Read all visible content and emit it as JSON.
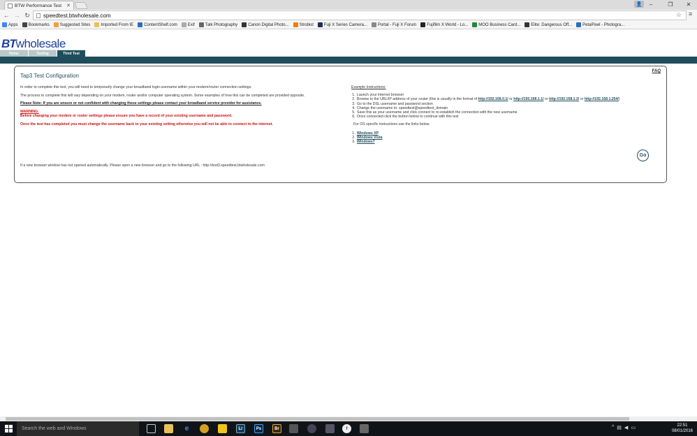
{
  "browser": {
    "tab_title": "BTW Performance Test",
    "url": "speedtest.btwholesale.com",
    "bookmarks": [
      {
        "label": "Apps",
        "icon": "apps-icon",
        "color": "#4285f4"
      },
      {
        "label": "Bookmarks",
        "icon": "star-icon",
        "color": "#444"
      },
      {
        "label": "Suggested Sites",
        "icon": "suggested-icon",
        "color": "#e8a33d"
      },
      {
        "label": "Imported From IE",
        "icon": "folder-icon",
        "color": "#e8c15a"
      },
      {
        "label": "ContentShelf.com",
        "icon": "contentshelf-icon",
        "color": "#2a6ebb"
      },
      {
        "label": "Exif",
        "icon": "document-icon",
        "color": "#aaa"
      },
      {
        "label": "Talk Photography",
        "icon": "talk-icon",
        "color": "#666"
      },
      {
        "label": "Canon Digital Photo...",
        "icon": "canon-icon",
        "color": "#333"
      },
      {
        "label": "Strobist",
        "icon": "blogger-icon",
        "color": "#f57d00"
      },
      {
        "label": "Fuji X Series Camera...",
        "icon": "fuji-icon",
        "color": "#1f2f5a"
      },
      {
        "label": "Portal - Fuji X Forum",
        "icon": "portal-icon",
        "color": "#888"
      },
      {
        "label": "Fujifilm X World - Lo...",
        "icon": "fujifilm-icon",
        "color": "#222"
      },
      {
        "label": "MOO Business Card...",
        "icon": "moo-icon",
        "color": "#1e8a3a"
      },
      {
        "label": "Elite: Dangerous Off...",
        "icon": "elite-icon",
        "color": "#333"
      },
      {
        "label": "PetaPixel - Photogra...",
        "icon": "petapixel-icon",
        "color": "#2a6ebb"
      }
    ]
  },
  "site": {
    "logo_bt": "BT",
    "logo_rest": "wholesale",
    "tabs": [
      {
        "label": "Home",
        "active": false
      },
      {
        "label": "Testing",
        "active": false
      },
      {
        "label": "Third Test",
        "active": true
      }
    ]
  },
  "panel": {
    "faq": "FAQ",
    "title": "Tap3 Test Configuration",
    "para1": "In order to complete this test, you will need to temporarily change your broadband login username within your modem/router connection settings.",
    "para2": "The process to complete this will vary depending on your modem, router and/or computer operating system. Some examples of how this can be completed are provided opposite.",
    "note": "Please Note: If you are unsure or not confident with changing these settings please contact your broadband service provider for assistance.",
    "warning_label": "WARNING:",
    "warning_text": "Before changing your modem or router settings please ensure you have a record of your existing username and password.",
    "warning_text2": "Once the test has completed you must change the username back to your existing setting otherwise you will not be able to connect to the internet.",
    "footer_note": "If a new browser window has not opened automatically. Please open a new browser and go to the following URL : http://test3.speedtest.btwholesale.com",
    "instructions_heading": "Example Instructions:",
    "step1": "Launch your internet browser",
    "step2_pre": "Browse to the URL/IP address of your router (this is usually in the format of",
    "ip1": "http://192.168.0.1/",
    "or1": "or",
    "ip2": "http://192.168.1.1/",
    "or2": "or",
    "ip3": "http://192.168.1.2/",
    "or3": "or",
    "ip4": "http://192.168.1.254/",
    "step2_post": ")",
    "step3": "Go to the DSL username and password section",
    "step4": "Change the username to: speedtest@speedtest_domain",
    "step5": "Save this as your username and click connect to re-establish the connection with the new username",
    "step6": "Once connected click the button below to continue with this test",
    "os_text": "For OS specific instructions use the links below.",
    "os_links": [
      "Windows XP",
      "Windows Vista",
      "Windows7"
    ],
    "go_label": "Go"
  },
  "taskbar": {
    "search_placeholder": "Search the web and Windows",
    "time": "22:51",
    "date": "08/01/2016"
  }
}
